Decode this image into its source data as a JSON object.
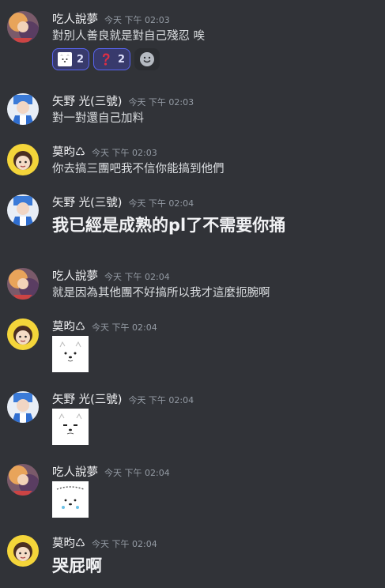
{
  "messages": [
    {
      "user": "吃人說夢",
      "time": "今天 下午 02:03",
      "text": "對別人善良就是對自己殘忍 唉"
    },
    {
      "user": "矢野 光(三號)",
      "time": "今天 下午 02:03",
      "text": "對一對還自己加料"
    },
    {
      "user": "莫昀♺",
      "time": "今天 下午 02:03",
      "text": "你去搞三團吧我不信你能搞到他們"
    },
    {
      "user": "矢野 光(三號)",
      "time": "今天 下午 02:04",
      "text": "我已經是成熟的pl了不需要你捅"
    },
    {
      "user": "吃人說夢",
      "time": "今天 下午 02:04",
      "text": "就是因為其他團不好搞所以我才這麼扼腕啊"
    },
    {
      "user": "莫昀♺",
      "time": "今天 下午 02:04"
    },
    {
      "user": "矢野 光(三號)",
      "time": "今天 下午 02:04"
    },
    {
      "user": "吃人說夢",
      "time": "今天 下午 02:04"
    },
    {
      "user": "莫昀♺",
      "time": "今天 下午 02:04",
      "text": "哭屁啊"
    }
  ],
  "reactions": [
    {
      "emoji": "dog-face-emoji",
      "count": "2"
    },
    {
      "emoji": "red-question-mark-emoji",
      "count": "2"
    }
  ],
  "icons": {
    "add_reaction": "add-reaction-smiley-icon"
  },
  "colors": {
    "background": "#313338",
    "accent": "#5865f2",
    "username": "#f2f3f5",
    "timestamp": "#949ba4"
  }
}
